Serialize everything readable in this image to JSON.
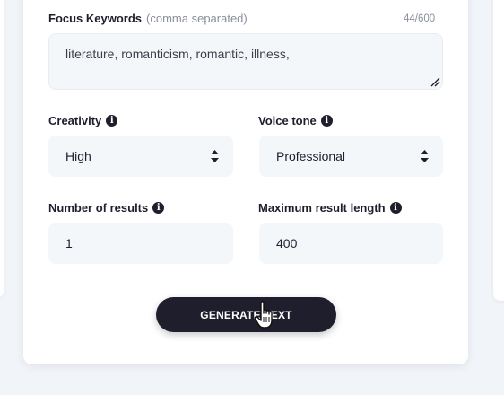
{
  "form": {
    "keywords": {
      "label": "Focus Keywords",
      "hint": "(comma separated)",
      "counter": "44/600",
      "value": "literature, romanticism, romantic, illness,"
    },
    "creativity": {
      "label": "Creativity",
      "value": "High"
    },
    "voice_tone": {
      "label": "Voice tone",
      "value": "Professional"
    },
    "num_results": {
      "label": "Number of results",
      "value": "1"
    },
    "max_length": {
      "label": "Maximum result length",
      "value": "400"
    },
    "generate_label": "GENERATE TEXT"
  },
  "colors": {
    "background": "#f1f4f8",
    "card": "#ffffff",
    "field_bg": "#f4f7fa",
    "button": "#1e1e2d",
    "hint": "#8a8f9c"
  },
  "icons": [
    "info-icon",
    "select-arrows-icon",
    "resize-handle-icon",
    "hand-cursor-icon"
  ]
}
